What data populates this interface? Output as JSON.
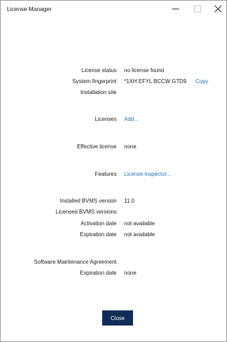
{
  "window": {
    "title": "License Manager"
  },
  "fields": {
    "license_status": {
      "label": "License status",
      "value": "no license found"
    },
    "system_fingerprint": {
      "label": "System fingerprint",
      "value": "*1XH EFYL BCCW GTD9",
      "copy": "Copy"
    },
    "installation_site": {
      "label": "Installation site",
      "value": ""
    },
    "licenses": {
      "label": "Licenses",
      "link": "Add..."
    },
    "effective_license": {
      "label": "Effective license",
      "value": "none"
    },
    "features": {
      "label": "Features",
      "link": "License inspector..."
    },
    "installed_version": {
      "label": "Installed BVMS version",
      "value": "11.0"
    },
    "licensed_versions": {
      "label": "Licensed BVMS versions",
      "value": ""
    },
    "activation_date": {
      "label": "Activation date",
      "value": "not available"
    },
    "expiration_date": {
      "label": "Expiration date",
      "value": "not available"
    },
    "sma": {
      "label": "Software Maintenance Agreement"
    },
    "sma_expiration": {
      "label": "Expiration date",
      "value": "none"
    }
  },
  "buttons": {
    "close": "Close"
  }
}
